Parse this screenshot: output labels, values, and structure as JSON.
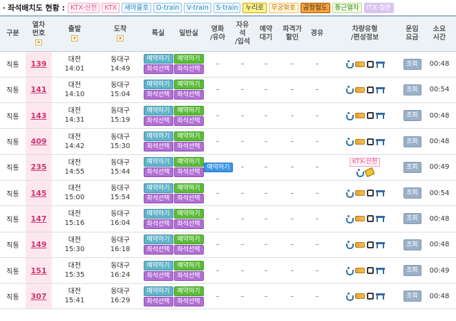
{
  "legend": {
    "title": "좌석배치도 현황 :",
    "items": [
      {
        "key": "ktxsan",
        "label": "KTX-산천"
      },
      {
        "key": "ktx",
        "label": "KTX"
      },
      {
        "key": "saemaeul",
        "label": "새마을호"
      },
      {
        "key": "otrain",
        "label": "O-train"
      },
      {
        "key": "vtrain",
        "label": "V-train"
      },
      {
        "key": "strain",
        "label": "S-train"
      },
      {
        "key": "nuriro",
        "label": "누리로"
      },
      {
        "key": "mugunghwa",
        "label": "무궁화호"
      },
      {
        "key": "airport",
        "label": "공항철도"
      },
      {
        "key": "commuter",
        "label": "통근열차"
      },
      {
        "key": "itx",
        "label": "ITX-청춘"
      }
    ]
  },
  "headers": {
    "category": "구분",
    "train_no": "열차\n번호",
    "depart": "출발",
    "arrive": "도착",
    "first_class": "특실",
    "general": "일반실",
    "infant": "영화\n/유아",
    "free_seat": "자유\n석\n/입석",
    "waitlist": "예약\n대기",
    "discount": "파격가\n할인",
    "via": "경유",
    "vehicle_type": "차량유형\n/편성정보",
    "fare": "운임\n요금",
    "duration": "소요\n시간"
  },
  "buttons": {
    "reserve": "예약하기",
    "seat_select": "좌석선택",
    "view": "조회",
    "dash": "–"
  },
  "rows": [
    {
      "type": "직통",
      "no": "139",
      "dep_station": "대전",
      "dep_time": "14:01",
      "arr_station": "동대구",
      "arr_time": "14:49",
      "infant": "–",
      "duration": "00:48",
      "vehicle_tag": ""
    },
    {
      "type": "직통",
      "no": "141",
      "dep_station": "대전",
      "dep_time": "14:10",
      "arr_station": "동대구",
      "arr_time": "15:04",
      "infant": "–",
      "duration": "00:54",
      "vehicle_tag": ""
    },
    {
      "type": "직통",
      "no": "143",
      "dep_station": "대전",
      "dep_time": "14:31",
      "arr_station": "동대구",
      "arr_time": "15:19",
      "infant": "–",
      "duration": "00:48",
      "vehicle_tag": ""
    },
    {
      "type": "직통",
      "no": "409",
      "dep_station": "대전",
      "dep_time": "14:42",
      "arr_station": "동대구",
      "arr_time": "15:30",
      "infant": "–",
      "duration": "00:48",
      "vehicle_tag": ""
    },
    {
      "type": "직통",
      "no": "235",
      "dep_station": "대전",
      "dep_time": "14:55",
      "arr_station": "동대구",
      "arr_time": "15:44",
      "infant": "예약하기",
      "duration": "00:49",
      "vehicle_tag": "KTX-산천"
    },
    {
      "type": "직통",
      "no": "145",
      "dep_station": "대전",
      "dep_time": "15:00",
      "arr_station": "동대구",
      "arr_time": "15:54",
      "infant": "–",
      "duration": "00:54",
      "vehicle_tag": ""
    },
    {
      "type": "직통",
      "no": "147",
      "dep_station": "대전",
      "dep_time": "15:16",
      "arr_station": "동대구",
      "arr_time": "16:04",
      "infant": "–",
      "duration": "00:48",
      "vehicle_tag": ""
    },
    {
      "type": "직통",
      "no": "149",
      "dep_station": "대전",
      "dep_time": "15:30",
      "arr_station": "동대구",
      "arr_time": "16:18",
      "infant": "–",
      "duration": "00:48",
      "vehicle_tag": ""
    },
    {
      "type": "직통",
      "no": "151",
      "dep_station": "대전",
      "dep_time": "15:35",
      "arr_station": "동대구",
      "arr_time": "16:24",
      "infant": "–",
      "duration": "00:49",
      "vehicle_tag": ""
    },
    {
      "type": "직통",
      "no": "307",
      "dep_station": "대전",
      "dep_time": "15:41",
      "arr_station": "동대구",
      "arr_time": "16:29",
      "infant": "–",
      "duration": "00:48",
      "vehicle_tag": ""
    }
  ]
}
